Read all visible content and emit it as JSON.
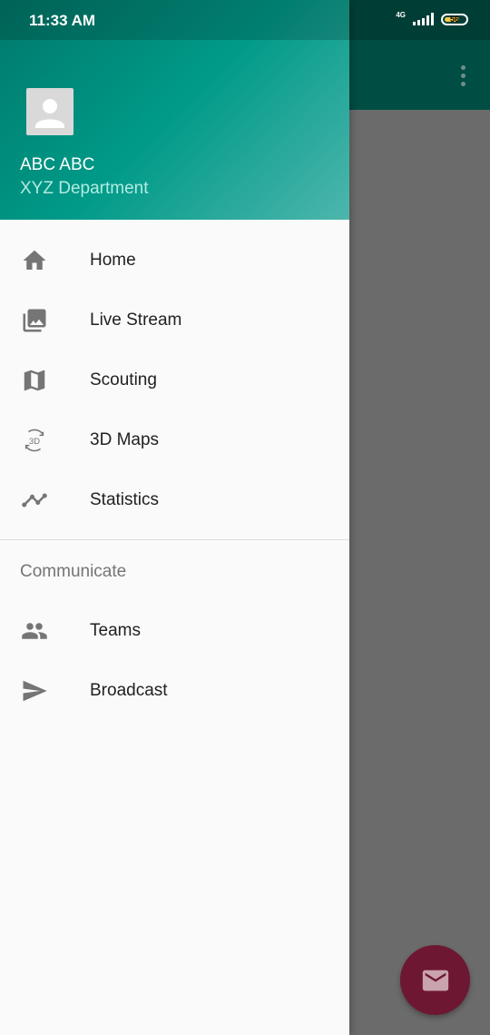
{
  "status_bar": {
    "time": "11:33 AM",
    "network": "4G",
    "battery": "56"
  },
  "drawer": {
    "user_name": "ABC ABC",
    "department": "XYZ Department",
    "items": [
      {
        "label": "Home",
        "icon": "home-icon"
      },
      {
        "label": "Live Stream",
        "icon": "photo-library-icon"
      },
      {
        "label": "Scouting",
        "icon": "map-icon"
      },
      {
        "label": "3D Maps",
        "icon": "3d-rotation-icon"
      },
      {
        "label": "Statistics",
        "icon": "timeline-icon"
      }
    ],
    "section_title": "Communicate",
    "communicate_items": [
      {
        "label": "Teams",
        "icon": "people-icon"
      },
      {
        "label": "Broadcast",
        "icon": "send-icon"
      }
    ]
  },
  "colors": {
    "header_start": "#00796b",
    "header_end": "#4db6ac",
    "fab": "#6e1732",
    "toolbar": "#004d43"
  },
  "fab": {
    "icon": "email-icon"
  }
}
